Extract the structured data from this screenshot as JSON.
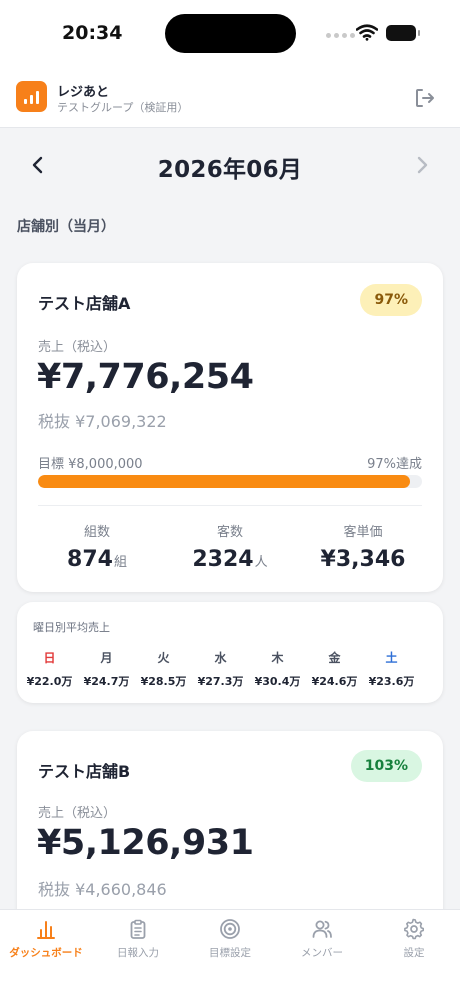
{
  "status_bar": {
    "time": "20:34"
  },
  "app": {
    "name": "レジあと",
    "group": "テストグループ（検証用）"
  },
  "month": {
    "title": "2026年06月"
  },
  "section_label": "店舗別（当月）",
  "store_a": {
    "name": "テスト店舗A",
    "badge": "97%",
    "sales_label": "売上（税込）",
    "sales": "¥7,776,254",
    "sales_net": "税抜 ¥7,069,322",
    "target_label": "目標 ¥8,000,000",
    "achieve_label": "97%達成",
    "progress_fraction": 0.97,
    "stats": [
      {
        "label": "組数",
        "value": "874",
        "unit": "組"
      },
      {
        "label": "客数",
        "value": "2324",
        "unit": "人"
      },
      {
        "label": "客単価",
        "value": "¥3,346",
        "unit": ""
      }
    ]
  },
  "weekday_avg": {
    "title": "曜日別平均売上",
    "days": [
      {
        "day": "日",
        "value": "¥22.0万"
      },
      {
        "day": "月",
        "value": "¥24.7万"
      },
      {
        "day": "火",
        "value": "¥28.5万"
      },
      {
        "day": "水",
        "value": "¥27.3万"
      },
      {
        "day": "木",
        "value": "¥30.4万"
      },
      {
        "day": "金",
        "value": "¥24.6万"
      },
      {
        "day": "土",
        "value": "¥23.6万"
      }
    ]
  },
  "store_b": {
    "name": "テスト店舗B",
    "badge": "103%",
    "sales_label": "売上（税込）",
    "sales": "¥5,126,931",
    "sales_net": "税抜 ¥4,660,846"
  },
  "tabs": [
    {
      "label": "ダッシュボード",
      "icon": "bar-chart-icon",
      "active": true
    },
    {
      "label": "日報入力",
      "icon": "clipboard-icon",
      "active": false
    },
    {
      "label": "目標設定",
      "icon": "target-icon",
      "active": false
    },
    {
      "label": "メンバー",
      "icon": "users-icon",
      "active": false
    },
    {
      "label": "設定",
      "icon": "gear-icon",
      "active": false
    }
  ],
  "colors": {
    "accent": "#f7801a",
    "progress": "#f98b12",
    "badge_a_bg": "#fdf0b8",
    "badge_b_bg": "#d9f6e2",
    "sunday": "#e23b3b",
    "saturday": "#2f6fd6"
  }
}
